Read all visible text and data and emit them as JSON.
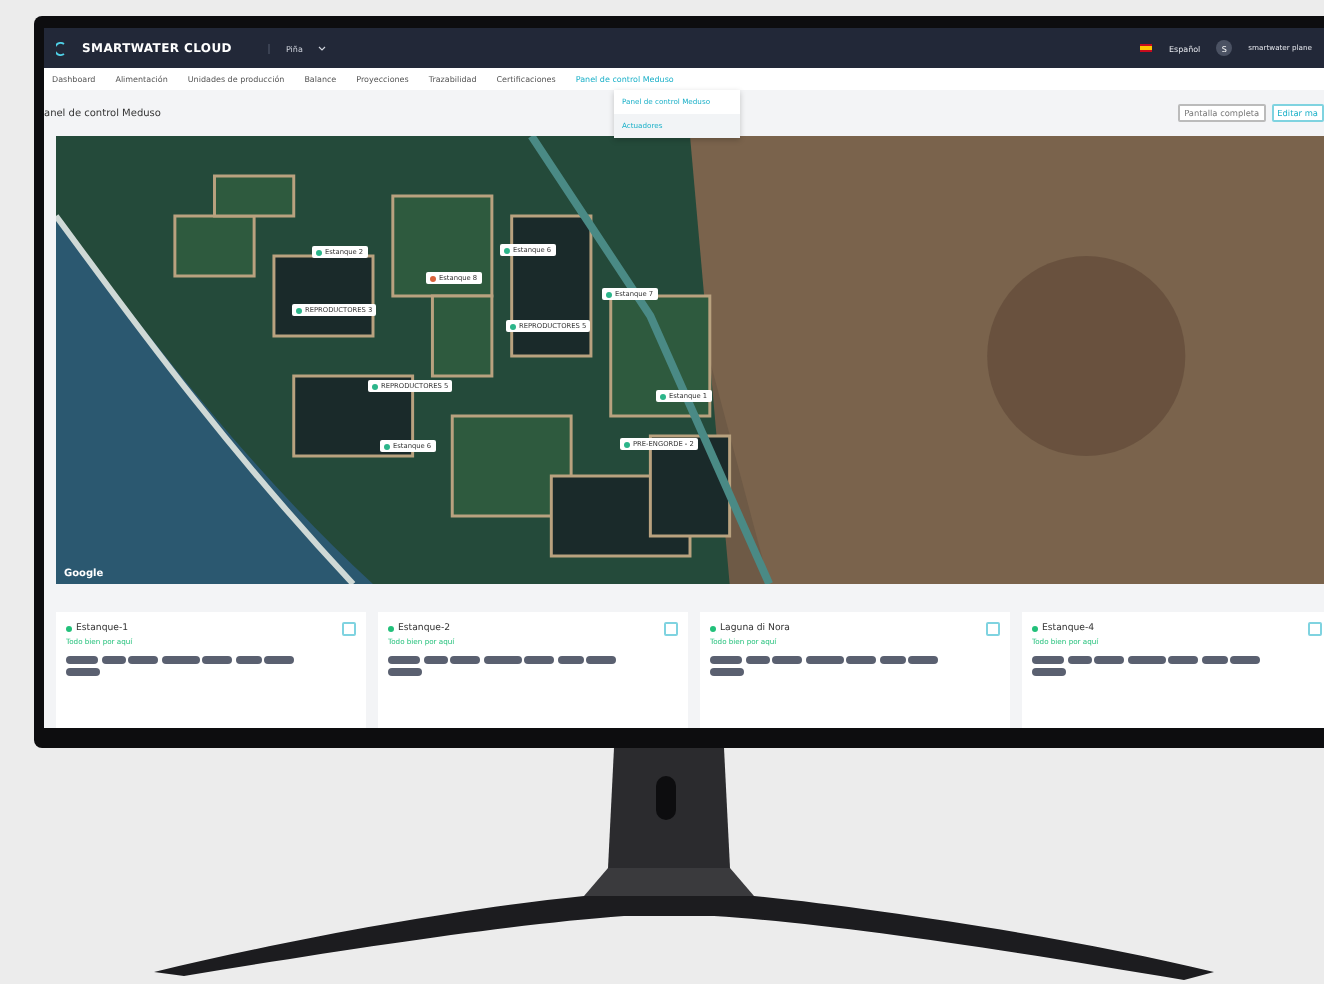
{
  "header": {
    "brand": "SMARTWATER CLOUD",
    "farm": "Piña",
    "language": "Español",
    "avatar": "S",
    "user": "smartwater plane"
  },
  "nav": [
    {
      "label": "Dashboard",
      "selected": false
    },
    {
      "label": "Alimentación",
      "selected": false
    },
    {
      "label": "Unidades de producción",
      "selected": false
    },
    {
      "label": "Balance",
      "selected": false
    },
    {
      "label": "Proyecciones",
      "selected": false
    },
    {
      "label": "Trazabilidad",
      "selected": false
    },
    {
      "label": "Certificaciones",
      "selected": false
    },
    {
      "label": "Panel de control Meduso",
      "selected": true
    }
  ],
  "dropdown": [
    {
      "label": "Panel de control Meduso",
      "selected": true
    },
    {
      "label": "Actuadores",
      "selected": false
    }
  ],
  "page_title": "anel de control Meduso",
  "buttons": [
    "Pantalla completa",
    "Editar ma"
  ],
  "map": {
    "credit": "Google",
    "markers": [
      {
        "label": "Estanque 2",
        "color": "#2bb58a"
      },
      {
        "label": "Estanque 6",
        "color": "#2bb58a"
      },
      {
        "label": "Estanque 8",
        "color": "#d9623b"
      },
      {
        "label": "Estanque 7",
        "color": "#2bb58a"
      },
      {
        "label": "REPRODUCTORES 3",
        "color": "#2bb58a"
      },
      {
        "label": "REPRODUCTORES 5",
        "color": "#2bb58a"
      },
      {
        "label": "REPRODUCTORES 5",
        "color": "#2bb58a"
      },
      {
        "label": "Estanque 1",
        "color": "#2bb58a"
      },
      {
        "label": "Estanque 6",
        "color": "#2bb58a"
      },
      {
        "label": "PRE-ENGORDE - 2",
        "color": "#2bb58a"
      }
    ]
  },
  "cards": [
    {
      "name": "Estanque-1",
      "status": "Todo bien por aquí",
      "color": "#22c07a"
    },
    {
      "name": "Estanque-2",
      "status": "Todo bien por aquí",
      "color": "#22c07a"
    },
    {
      "name": "Laguna di Nora",
      "status": "Todo bien por aquí",
      "color": "#22c07a"
    },
    {
      "name": "Estanque-4",
      "status": "Todo bien por aquí",
      "color": "#22c07a"
    }
  ]
}
